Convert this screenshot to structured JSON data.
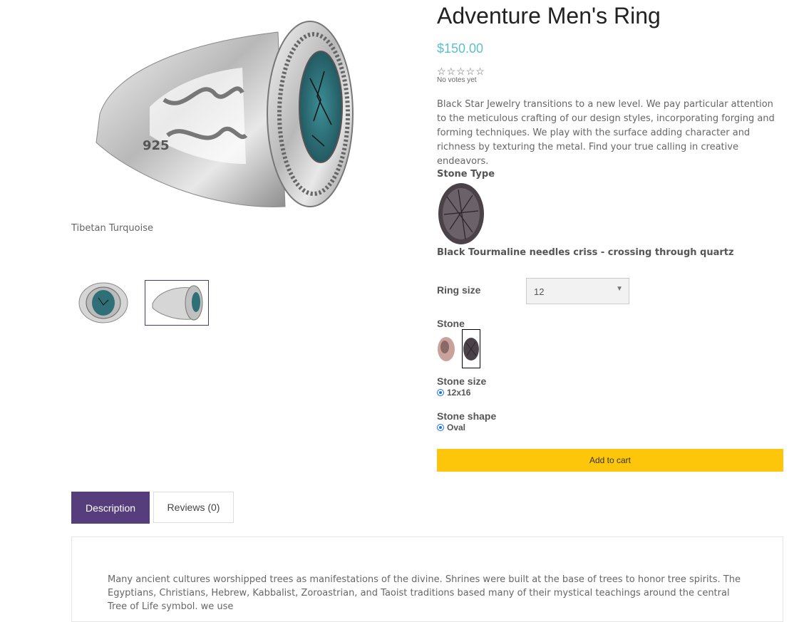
{
  "product": {
    "title": "Adventure Men's Ring",
    "price": "$150.00",
    "stars": "☆☆☆☆☆",
    "votes": "No votes yet",
    "description": "Black Star Jewelry transitions to a new level. We pay particular attention to the meticulous crafting of our design styles, incorporating forging and forming techniques. We play with the surface adding character and richness by texturing the metal. Find your true calling in creative endeavors."
  },
  "gallery": {
    "caption": "Tibetan Turquoise"
  },
  "options": {
    "stone_type_label": "Stone Type",
    "stone_type_name": "Black Tourmaline needles criss - crossing through quartz",
    "ring_size_label": "Ring size",
    "ring_size_value": "12",
    "stone_label": "Stone",
    "stone_size_label": "Stone size",
    "stone_size_option": "12x16",
    "stone_shape_label": "Stone shape",
    "stone_shape_option": "Oval"
  },
  "actions": {
    "add_to_cart": "Add to cart"
  },
  "tabs": [
    {
      "label": "Description"
    },
    {
      "label": "Reviews (0)"
    }
  ],
  "tab_content": "Many ancient cultures worshipped trees as manifestations of the divine. Shrines were built at the base of trees to honor tree spirits. The Egyptians, Christians, Hebrew, Kabbalist, Zoroastrian, and Taoist traditions based many of their mystical teachings around the central Tree of Life symbol. we use",
  "colors": {
    "accent_price": "#5bc0c9",
    "add_to_cart": "#fec60a",
    "active_tab": "#563d7c"
  }
}
